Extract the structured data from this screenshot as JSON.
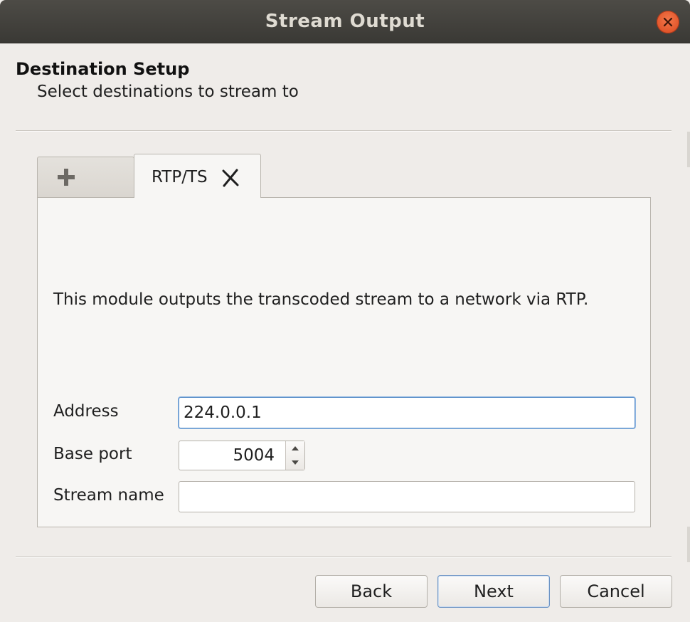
{
  "window": {
    "title": "Stream Output"
  },
  "header": {
    "title": "Destination Setup",
    "subtitle": "Select destinations to stream to"
  },
  "tabs": [
    {
      "label": "",
      "icon": "plus-icon"
    },
    {
      "label": "RTP/TS",
      "icon": "close-x-icon"
    }
  ],
  "panel": {
    "description": "This module outputs the transcoded stream to a network via RTP.",
    "address": {
      "label": "Address",
      "value": "224.0.0.1"
    },
    "base_port": {
      "label": "Base port",
      "value": "5004"
    },
    "stream_name": {
      "label": "Stream name",
      "value": "",
      "placeholder": ""
    }
  },
  "buttons": {
    "back": "Back",
    "next": "Next",
    "cancel": "Cancel"
  },
  "colors": {
    "titlebar": "#3f3e3a",
    "title_text": "#dfdbd2",
    "close_button": "#e95420",
    "background": "#efece9",
    "focus_border": "#5b8fc9"
  }
}
